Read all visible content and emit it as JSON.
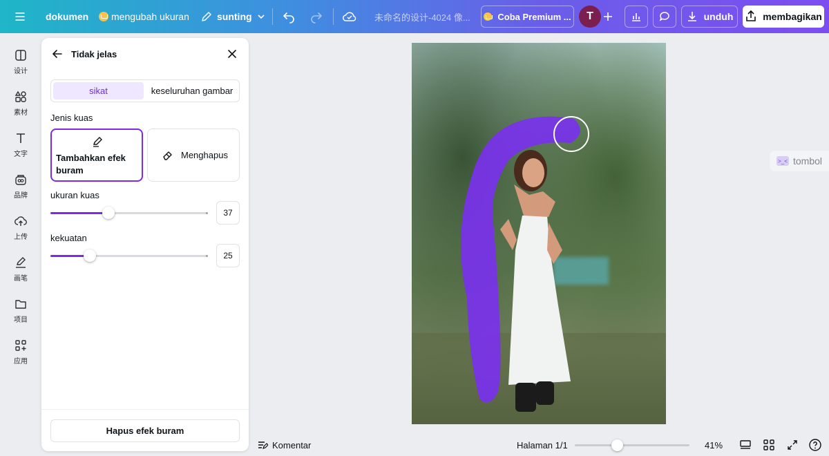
{
  "topbar": {
    "menu_icon": "hamburger-icon",
    "file_label": "dokumen",
    "resize_label": "mengubah ukuran",
    "edit_label": "sunting",
    "doc_title": "未命名的设计-4024 像...",
    "premium_label": "Coba Premium ...",
    "avatar_letter": "T",
    "download_label": "unduh",
    "share_label": "membagikan"
  },
  "rail": {
    "items": [
      {
        "label": "设计",
        "icon": "layout-icon"
      },
      {
        "label": "素材",
        "icon": "shapes-icon"
      },
      {
        "label": "文字",
        "icon": "text-icon"
      },
      {
        "label": "品牌",
        "icon": "brand-icon"
      },
      {
        "label": "上传",
        "icon": "upload-cloud-icon"
      },
      {
        "label": "画笔",
        "icon": "draw-icon"
      },
      {
        "label": "项目",
        "icon": "folder-icon"
      },
      {
        "label": "应用",
        "icon": "apps-icon"
      }
    ]
  },
  "panel": {
    "title": "Tidak jelas",
    "tab_brush": "sikat",
    "tab_whole": "keseluruhan gambar",
    "brush_type_label": "Jenis kuas",
    "add_blur_label": "Tambahkan efek buram",
    "erase_label": "Menghapus",
    "size_label": "ukuran kuas",
    "size_value": "37",
    "size_fraction": 0.37,
    "strength_label": "kekuatan",
    "strength_value": "25",
    "strength_fraction": 0.25,
    "remove_label": "Hapus efek buram"
  },
  "canvas": {
    "side_button": "tombol"
  },
  "bottombar": {
    "comment_label": "Komentar",
    "page_label": "Halaman 1/1",
    "zoom_value": "41%"
  },
  "colors": {
    "accent": "#7d2ae8",
    "brush_stroke": "#7a30f0"
  }
}
